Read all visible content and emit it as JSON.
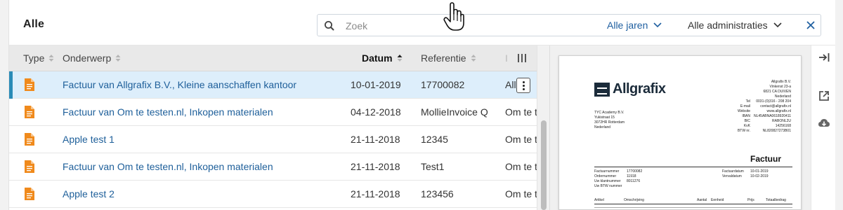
{
  "header": {
    "title": "Alle",
    "search_placeholder": "Zoek",
    "filter_years": "Alle jaren",
    "filter_admin": "Alle administraties"
  },
  "table": {
    "columns": {
      "type": "Type",
      "subject": "Onderwerp",
      "date": "Datum",
      "reference": "Referentie",
      "extra": "I"
    },
    "rows": [
      {
        "subject": "Factuur van Allgrafix B.V., Kleine aanschaffen kantoor",
        "date": "10-01-2019",
        "reference": "17700082",
        "extra": "Allgr",
        "selected": true
      },
      {
        "subject": "Factuur van Om te testen.nl, Inkopen materialen",
        "date": "04-12-2018",
        "reference": "MollieInvoice Q",
        "extra": "Om te t"
      },
      {
        "subject": "Apple test 1",
        "date": "21-11-2018",
        "reference": "12345",
        "extra": "Om te t"
      },
      {
        "subject": "Factuur van Om te testen.nl, Inkopen materialen",
        "date": "21-11-2018",
        "reference": "Test1",
        "extra": "Om te t"
      },
      {
        "subject": "Apple test 2",
        "date": "21-11-2018",
        "reference": "123456",
        "extra": "Om te t"
      }
    ]
  },
  "preview": {
    "logo": "Allgrafix",
    "sender": [
      "Allgrafix B.V.",
      "Vinkenst 23-a",
      "6821 CA  DUIVEN",
      "Nederland"
    ],
    "contact_labels": [
      "Tel",
      "E-mail",
      "Website",
      "IBAN",
      "BIC",
      "KvK",
      "BTW nr."
    ],
    "contact_values": [
      "0031-(0)316 - 208 204",
      "contact@allgrafix.nl",
      "www.allgrafix.nl",
      "NL45ABNA0618920411",
      "RABONL2U",
      "14256168",
      "NL820827273B01"
    ],
    "recipient": [
      "TYC Academy B.V.",
      "Yukistraat 15",
      "3072HR Rotterdam",
      "Nederland"
    ],
    "invoice_title": "Factuur",
    "meta_labels": [
      "Factuurnummer",
      "Ordernummer",
      "Uw klantnummer",
      "Uw BTW nummer"
    ],
    "meta_values": [
      "17700082",
      "11918",
      "8011276",
      ""
    ],
    "meta_right_labels": [
      "Factuurdatum",
      "Vervaldatum"
    ],
    "meta_right_values": [
      "10-01-2019",
      "10-02-2019"
    ],
    "line_headers": [
      "Artikel",
      "Omschrijving",
      "Aantal",
      "Eenheid",
      "Prijs",
      "Totaalbedrag"
    ]
  },
  "colors": {
    "accent": "#1f5fa0",
    "selected_row": "#ddeefb",
    "selection_bar": "#2a8bb7",
    "doc_icon": "#f08a1c"
  }
}
